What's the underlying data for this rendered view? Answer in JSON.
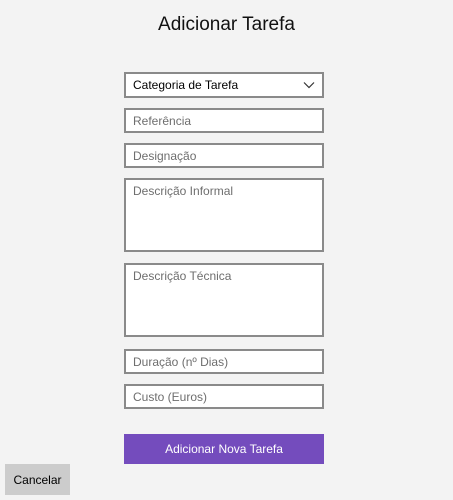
{
  "page": {
    "title": "Adicionar Tarefa"
  },
  "form": {
    "category_select": {
      "selected": "Categoria de Tarefa",
      "icon": "chevron-down-icon"
    },
    "reference_placeholder": "Referência",
    "designation_placeholder": "Designação",
    "informal_description_placeholder": "Descrição Informal",
    "technical_description_placeholder": "Descrição Técnica",
    "duration_placeholder": "Duração (nº Dias)",
    "cost_placeholder": "Custo (Euros)",
    "submit_label": "Adicionar Nova Tarefa"
  },
  "footer": {
    "cancel_label": "Cancelar"
  },
  "colors": {
    "background": "#f3f3f3",
    "accent": "#744cbd",
    "field_border": "#8a8a8a",
    "cancel_button": "#cccccc"
  }
}
